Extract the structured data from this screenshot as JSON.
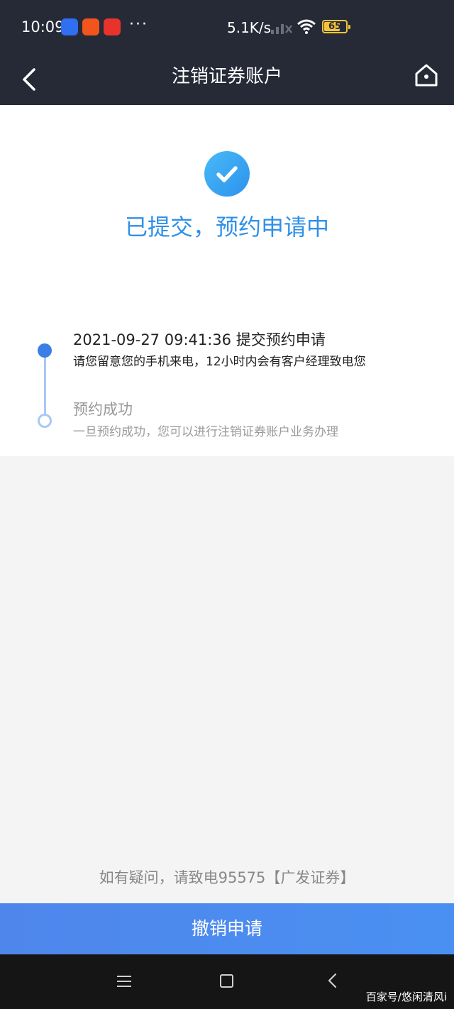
{
  "status_bar": {
    "time": "10:09",
    "more": "···",
    "network_speed": "5.1K/s",
    "battery_level": "65",
    "colors": {
      "background": "#262a37",
      "battery": "#f3c33a"
    }
  },
  "nav": {
    "title": "注销证券账户",
    "back_icon": "chevron-left-icon",
    "home_icon": "home-icon"
  },
  "result": {
    "icon": "check-circle-icon",
    "title": "已提交，预约申请中",
    "color": "#2f90e8"
  },
  "timeline": {
    "steps": [
      {
        "title": "2021-09-27 09:41:36 提交预约申请",
        "desc": "请您留意您的手机来电，12小时内会有客户经理致电您",
        "state": "done"
      },
      {
        "title": "预约成功",
        "desc": "一旦预约成功，您可以进行注销证券账户业务办理",
        "state": "pending"
      }
    ],
    "colors": {
      "active": "#3a7ee6",
      "line": "#a9c8f4"
    }
  },
  "footer": {
    "hotline": "如有疑问，请致电95575【广发证券】",
    "cancel_label": "撤销申请",
    "button_color": "#4f86ec"
  },
  "watermark": "百家号/悠闲清风i",
  "system_nav": {
    "icons": [
      "menu-icon",
      "home-square-icon",
      "back-triangle-icon"
    ]
  }
}
